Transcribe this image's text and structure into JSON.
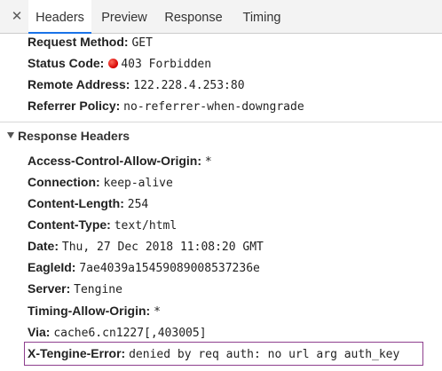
{
  "tabs": {
    "close_label": "✕",
    "items": [
      {
        "label": "Headers"
      },
      {
        "label": "Preview"
      },
      {
        "label": "Response"
      },
      {
        "label": "Timing"
      }
    ]
  },
  "general": {
    "request_method": {
      "key": "Request Method:",
      "value": "GET"
    },
    "status_code": {
      "key": "Status Code:",
      "value": "403 Forbidden",
      "dot_color": "#e00000"
    },
    "remote_address": {
      "key": "Remote Address:",
      "value": "122.228.4.253:80"
    },
    "referrer_policy": {
      "key": "Referrer Policy:",
      "value": "no-referrer-when-downgrade"
    }
  },
  "response_headers": {
    "title": "Response Headers",
    "items": [
      {
        "key": "Access-Control-Allow-Origin:",
        "value": "*"
      },
      {
        "key": "Connection:",
        "value": "keep-alive"
      },
      {
        "key": "Content-Length:",
        "value": "254"
      },
      {
        "key": "Content-Type:",
        "value": "text/html"
      },
      {
        "key": "Date:",
        "value": "Thu, 27 Dec 2018 11:08:20 GMT"
      },
      {
        "key": "EagleId:",
        "value": "7ae4039a15459089008537236e"
      },
      {
        "key": "Server:",
        "value": "Tengine"
      },
      {
        "key": "Timing-Allow-Origin:",
        "value": "*"
      },
      {
        "key": "Via:",
        "value": "cache6.cn1227[,403005]"
      },
      {
        "key": "X-Tengine-Error:",
        "value": "denied by req auth: no url arg auth_key"
      }
    ]
  },
  "colors": {
    "active_tab_underline": "#1a73e8",
    "highlight_border": "#8e3f8e"
  }
}
